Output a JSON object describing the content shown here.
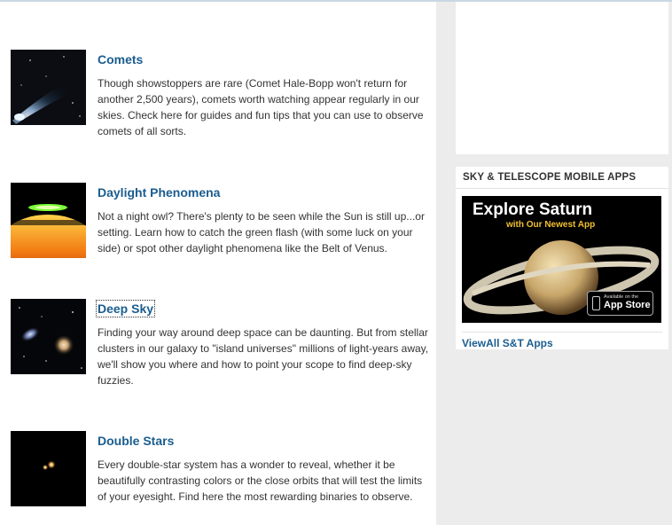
{
  "articles": [
    {
      "title": "Comets",
      "description": "Though showstoppers are rare (Comet Hale-Bopp won't return for another 2,500 years), comets worth watching appear regularly in our skies. Check here for guides and fun tips that you can use to observe comets of all sorts."
    },
    {
      "title": "Daylight Phenomena",
      "description": "Not a night owl? There's plenty to be seen while the Sun is still up...or setting. Learn how to catch the green flash (with some luck on your side) or spot other daylight phenomena like the Belt of Venus."
    },
    {
      "title": "Deep Sky",
      "description": "Finding your way around deep space can be daunting. But from stellar clusters in our galaxy to \"island universes\" millions of light-years away, we'll show you where and how to point your scope to find deep-sky fuzzies."
    },
    {
      "title": "Double Stars",
      "description": "Every double-star system has a wonder to reveal, whether it be beautifully contrasting colors or the close orbits that will test the limits of your eyesight. Find here the most rewarding binaries to observe."
    }
  ],
  "sidebar": {
    "apps_heading": "SKY & TELESCOPE MOBILE APPS",
    "banner_title": "Explore Saturn",
    "banner_subtitle": "with Our Newest App",
    "appstore_small": "Available on the",
    "appstore_big": "App Store",
    "view_all_link": "ViewAll S&T Apps"
  }
}
